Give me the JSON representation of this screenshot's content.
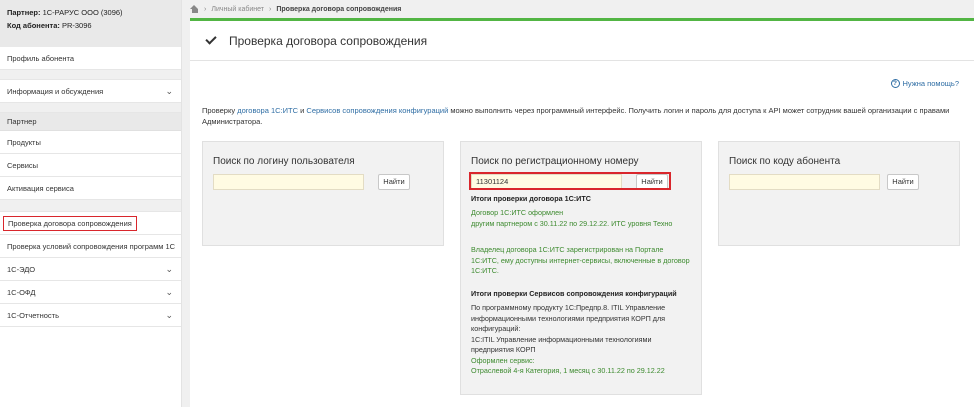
{
  "sidebar": {
    "partner_label": "Партнер:",
    "partner_value": "1С-РАРУС ООО (3096)",
    "subscriber_label": "Код абонента:",
    "subscriber_value": "PR-3096",
    "profile": "Профиль абонента",
    "info": "Информация и обсуждения",
    "partner_head": "Партнер",
    "products": "Продукты",
    "services": "Сервисы",
    "activation": "Активация сервиса",
    "check_contract": "Проверка договора сопровождения",
    "check_conditions": "Проверка условий сопровождения программ 1С",
    "edo": "1С-ЭДО",
    "ofd": "1С-ОФД",
    "reporting": "1С-Отчетность"
  },
  "breadcrumb": {
    "cabinet": "Личный кабинет",
    "current": "Проверка договора сопровождения"
  },
  "panel": {
    "title": "Проверка договора сопровождения",
    "help": "Нужна помощь?",
    "intro_1": "Проверку ",
    "intro_link1": "договора 1С:ИТС",
    "intro_2": " и ",
    "intro_link2": "Сервисов сопровождения конфигураций",
    "intro_3": " можно выполнить через программный интерфейс. Получить логин и пароль для доступа к API может сотрудник вашей организации с правами Администратора."
  },
  "search_login": {
    "title": "Поиск по логину пользователя",
    "value": "",
    "button": "Найти"
  },
  "search_reg": {
    "title": "Поиск по регистрационному номеру",
    "value": "11301124",
    "button": "Найти",
    "its_title": "Итоги проверки договора 1С:ИТС",
    "its_line1": "Договор 1С:ИТС оформлен",
    "its_line2": "другим партнером с 30.11.22 по 29.12.22. ИТС уровня Техно",
    "owner_line1": "Владелец договора 1С:ИТС зарегистрирован на Портале",
    "owner_line2": "1С:ИТС, ему доступны интернет-сервисы, включенные в договор",
    "owner_line3": "1С:ИТС.",
    "svc_title": "Итоги проверки Сервисов сопровождения конфигураций",
    "svc_line1": "По программному продукту 1С:Предпр.8. ITIL Управление",
    "svc_line2": "информационными технологиями предприятия КОРП для",
    "svc_line3": "конфигураций:",
    "svc_line4": "1С:ITIL Управление информационными технологиями",
    "svc_line5": "предприятия КОРП",
    "svc_line6": "Оформлен сервис:",
    "svc_line7": "Отраслевой 4-я Категория, 1 месяц с 30.11.22 по 29.12.22"
  },
  "search_code": {
    "title": "Поиск по коду абонента",
    "value": "",
    "button": "Найти"
  }
}
